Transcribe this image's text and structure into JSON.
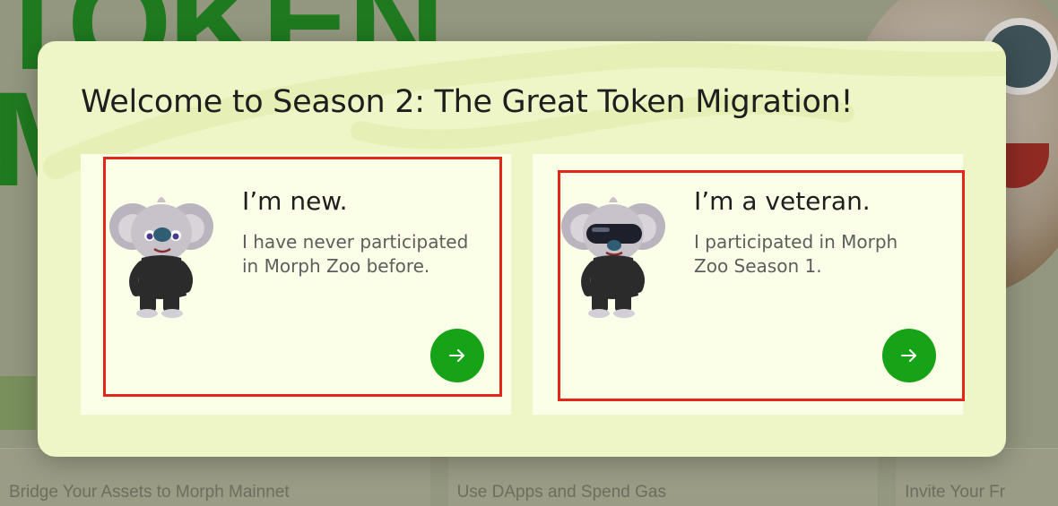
{
  "background": {
    "hero_line1": "TOKEN",
    "hero_line2": "M",
    "cards": [
      "Bridge Your Assets to Morph Mainnet",
      "Use DApps and Spend Gas",
      "Invite Your Fr"
    ]
  },
  "modal": {
    "title": "Welcome to Season 2: The Great Token Migration!",
    "options": [
      {
        "title": "I’m new.",
        "description": "I have never participated in Morph Zoo before.",
        "button_icon": "arrow-right-icon"
      },
      {
        "title": "I’m a veteran.",
        "description": "I participated in Morph Zoo Season 1.",
        "button_icon": "arrow-right-icon"
      }
    ]
  },
  "colors": {
    "modal_bg": "#eef5c6",
    "card_bg": "#fbffe8",
    "accent_green": "#17a317",
    "highlight_red": "#e3261a"
  }
}
